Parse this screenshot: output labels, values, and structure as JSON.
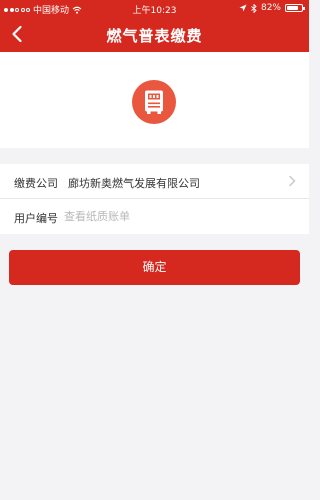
{
  "status_bar": {
    "carrier": "中国移动",
    "time": "上午10:23",
    "battery_text": "82%",
    "battery_level": 0.82,
    "signal_icon": "signal-dots-icon",
    "wifi_icon": "wifi-icon",
    "location_icon": "location-arrow-icon",
    "bluetooth_icon": "bluetooth-icon"
  },
  "nav": {
    "title": "燃气普表缴费",
    "back_icon": "back-chevron-icon"
  },
  "logo": {
    "icon": "gas-meter-icon",
    "color": "#e9573f"
  },
  "form": {
    "company_label": "缴费公司",
    "company_value": "廊坊新奥燃气发展有限公司",
    "chevron_icon": "chevron-right-icon",
    "user_label": "用户编号",
    "user_value": "",
    "user_placeholder": "查看纸质账单"
  },
  "confirm_label": "确定",
  "colors": {
    "brand": "#d5281e",
    "background": "#f3f3f5",
    "placeholder": "#b8b8b8"
  }
}
